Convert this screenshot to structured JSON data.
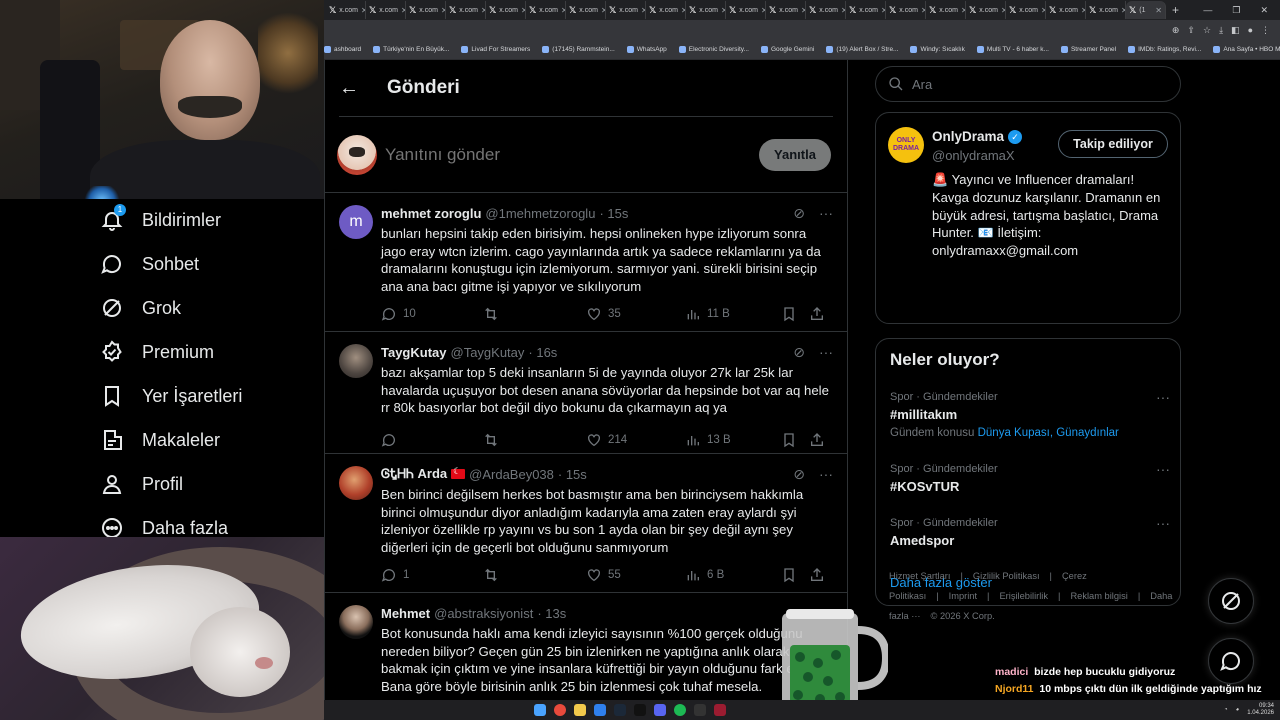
{
  "browser": {
    "tabs": [
      {
        "label": "x.com"
      },
      {
        "label": "x.com"
      },
      {
        "label": "x.com"
      },
      {
        "label": "x.com"
      },
      {
        "label": "x.com"
      },
      {
        "label": "x.com"
      },
      {
        "label": "x.com"
      },
      {
        "label": "x.com"
      },
      {
        "label": "x.com"
      },
      {
        "label": "x.com"
      },
      {
        "label": "x.com"
      },
      {
        "label": "x.com"
      },
      {
        "label": "x.com"
      },
      {
        "label": "x.com"
      },
      {
        "label": "x.com"
      },
      {
        "label": "x.com"
      },
      {
        "label": "x.com"
      },
      {
        "label": "x.com"
      },
      {
        "label": "x.com"
      },
      {
        "label": "x.com"
      }
    ],
    "active_tab": "(1",
    "bookmarks": [
      "ashboard",
      "Türkiye'nin En Büyük...",
      "Livad For Streamers",
      "(17145) Rammstein...",
      "WhatsApp",
      "Electronic Diversity...",
      "Google Gemini",
      "(19) Alert Box / Stre...",
      "Windy: Sıcaklık",
      "Multi TV - 6 haber k...",
      "Streamer Panel",
      "IMDb: Ratings, Revi...",
      "Ana Sayfa • HBO Max"
    ],
    "bookmarks_all": "Tüm Yer İşaretleri"
  },
  "nav": {
    "items": [
      {
        "label": "Bildirimler",
        "badge": "1"
      },
      {
        "label": "Sohbet"
      },
      {
        "label": "Grok"
      },
      {
        "label": "Premium"
      },
      {
        "label": "Yer İşaretleri"
      },
      {
        "label": "Makaleler"
      },
      {
        "label": "Profil"
      },
      {
        "label": "Daha fazla"
      }
    ]
  },
  "main": {
    "title": "Gönderi",
    "compose_placeholder": "Yanıtını gönder",
    "reply_button": "Yanıtla",
    "posts": [
      {
        "name": "mehmet zoroglu",
        "handle": "@1mehmetzoroglu",
        "time": "· 15s",
        "text": "bunları hepsini takip eden birisiyim. hepsi onlineken hype izliyorum sonra jago eray wtcn izlerim. cago yayınlarında artık ya sadece reklamlarını ya da dramalarını konuştugu için izlemiyorum. sarmıyor yani. sürekli birisini seçip ana ana bacı gitme işi yapıyor ve sıkılıyorum",
        "replies": "10",
        "reposts": "",
        "likes": "35",
        "views": "11 B"
      },
      {
        "name": "TaygKutay",
        "handle": "@TaygKutay",
        "time": "· 16s",
        "text": "bazı akşamlar top 5 deki insanların 5i de yayında oluyor 27k lar 25k lar havalarda uçuşuyor bot desen anana sövüyorlar da hepsinde bot var aq hele rr 80k basıyorlar bot değil diyo bokunu da çıkarmayın aq ya",
        "replies": "",
        "reposts": "",
        "likes": "214",
        "views": "13 B"
      },
      {
        "name": "ᎶᎿᎻᏂ Arda",
        "handle": "@ArdaBey038",
        "time": "· 15s",
        "text": "Ben birinci değilsem herkes bot basmıştır ama ben birinciysem hakkımla birinci olmuşundur diyor anladığım kadarıyla ama zaten eray aylardı şyi izleniyor özellikle rp yayını vs bu son 1 ayda olan bir şey değil aynı şey diğerleri için de geçerli bot olduğunu sanmıyorum",
        "replies": "1",
        "reposts": "",
        "likes": "55",
        "views": "6 B"
      },
      {
        "name": "Mehmet",
        "handle": "@abstraksiyonist",
        "time": "· 13s",
        "text": "Bot konusunda haklı ama kendi izleyici sayısının %100 gerçek olduğunu nereden biliyor? Geçen gün 25 bin izlenirken ne yaptığına anlık olarak bakmak için çıktım ve yine insanlara küfrettiği bir yayın olduğunu fark ettim. Bana göre böyle birisinin anlık 25 bin izlenmesi çok tuhaf mesela.",
        "replies": "",
        "reposts": "",
        "likes": "",
        "views": ""
      }
    ]
  },
  "sidebar": {
    "search_placeholder": "Ara",
    "profile": {
      "name": "OnlyDrama",
      "handle": "@onlydramaX",
      "follow_label": "Takip ediliyor",
      "logo_text": "ONLY DRAMA",
      "bio": "🚨 Yayıncı ve Influencer dramaları! Kavga dozunuz karşılanır. Dramanın en büyük adresi, tartışma başlatıcı, Drama Hunter. 📧 İletişim: onlydramaxx@gmail.com"
    },
    "trends_title": "Neler oluyor?",
    "trends": [
      {
        "meta": "Spor · Gündemdekiler",
        "name": "#millitakım",
        "sub_prefix": "Gündem konusu",
        "sub_link": "Dünya Kupası, Günaydınlar"
      },
      {
        "meta": "Spor · Gündemdekiler",
        "name": "#KOSvTUR",
        "sub_prefix": "",
        "sub_link": ""
      },
      {
        "meta": "Spor · Gündemdekiler",
        "name": "Amedspor",
        "sub_prefix": "",
        "sub_link": ""
      }
    ],
    "show_more": "Daha fazla göster",
    "footer": [
      "Hizmet Şartları",
      "|",
      "Gizlilik Politikası",
      "|",
      "Çerez Politikası",
      "|",
      "Imprint",
      "|",
      "Erişilebilirlik",
      "|",
      "Reklam bilgisi",
      "|",
      "Daha fazla ···",
      "© 2026 X Corp."
    ]
  },
  "chat": [
    {
      "user": "madici",
      "msg": "bizde hep bucuklu gidiyoruz"
    },
    {
      "user": "Njord11",
      "msg": "10 mbps çıktı dün ilk geldiğinde yaptığım hız testinde"
    }
  ],
  "taskbar": {
    "time": "09:34",
    "date": "1.04.2026"
  },
  "colors": {
    "accent": "#1d9bf0",
    "background": "#000000",
    "border": "#2f3336",
    "muted_text": "#71767b"
  }
}
